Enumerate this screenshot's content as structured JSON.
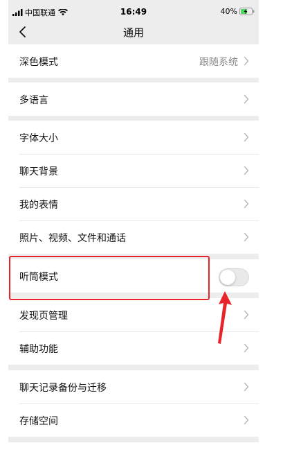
{
  "status_bar": {
    "carrier": "中国联通",
    "time": "16:49",
    "battery_percent": "40%"
  },
  "nav": {
    "title": "通用"
  },
  "settings": {
    "dark_mode": {
      "label": "深色模式",
      "value": "跟随系统"
    },
    "language": {
      "label": "多语言"
    },
    "font_size": {
      "label": "字体大小"
    },
    "chat_background": {
      "label": "聊天背景"
    },
    "my_stickers": {
      "label": "我的表情"
    },
    "media_files": {
      "label": "照片、视频、文件和通话"
    },
    "earpiece_mode": {
      "label": "听筒模式",
      "enabled": false
    },
    "discover_management": {
      "label": "发现页管理"
    },
    "accessibility": {
      "label": "辅助功能"
    },
    "chat_backup": {
      "label": "聊天记录备份与迁移"
    },
    "storage": {
      "label": "存储空间"
    }
  },
  "colors": {
    "annotation": "#e8232a",
    "page_background": "#ededed",
    "battery_charging": "#4cd964"
  },
  "icons": {
    "back": "chevron-left-icon",
    "row_arrow": "chevron-right-icon"
  }
}
